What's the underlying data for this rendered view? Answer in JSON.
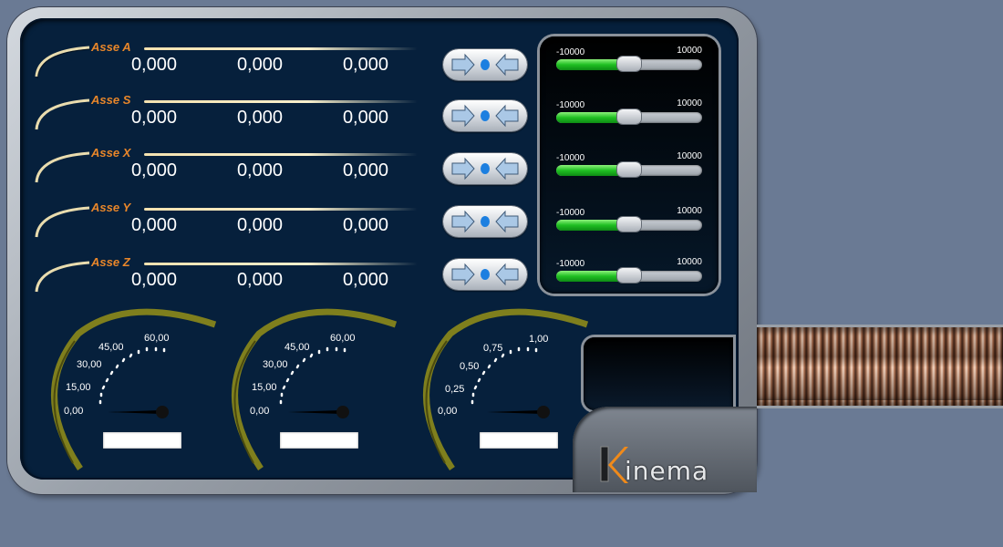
{
  "axes": [
    {
      "name": "Asse A",
      "values": [
        "0,000",
        "0,000",
        "0,000"
      ]
    },
    {
      "name": "Asse S",
      "values": [
        "0,000",
        "0,000",
        "0,000"
      ]
    },
    {
      "name": "Asse X",
      "values": [
        "0,000",
        "0,000",
        "0,000"
      ]
    },
    {
      "name": "Asse Y",
      "values": [
        "0,000",
        "0,000",
        "0,000"
      ]
    },
    {
      "name": "Asse Z",
      "values": [
        "0,000",
        "0,000",
        "0,000"
      ]
    }
  ],
  "sliders": [
    {
      "min": "-10000",
      "max": "10000",
      "level": 0.5
    },
    {
      "min": "-10000",
      "max": "10000",
      "level": 0.5
    },
    {
      "min": "-10000",
      "max": "10000",
      "level": 0.5
    },
    {
      "min": "-10000",
      "max": "10000",
      "level": 0.5
    },
    {
      "min": "-10000",
      "max": "10000",
      "level": 0.5
    }
  ],
  "gauges": [
    {
      "ticks": [
        "0,00",
        "15,00",
        "30,00",
        "45,00",
        "60,00"
      ],
      "value": 0
    },
    {
      "ticks": [
        "0,00",
        "15,00",
        "30,00",
        "45,00",
        "60,00"
      ],
      "value": 0
    },
    {
      "ticks": [
        "0,00",
        "0,25",
        "0,50",
        "0,75",
        "1,00"
      ],
      "value": 0
    }
  ],
  "logo": {
    "text": "inema",
    "full": "Kinema"
  },
  "colors": {
    "accent": "#e8862a",
    "screen": "#06203c",
    "slider_fill": "#1fbf22",
    "gauge_arc": "#8d8a1a"
  }
}
